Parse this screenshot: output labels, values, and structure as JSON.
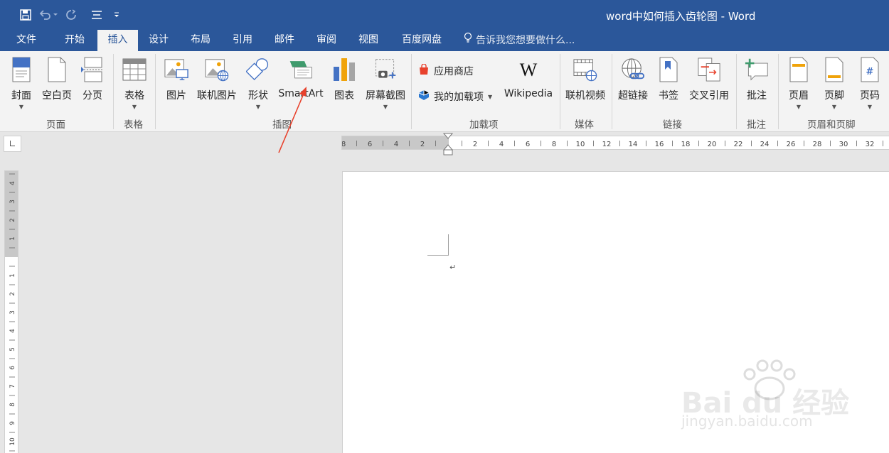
{
  "window": {
    "title": "word中如何插入齿轮图 - Word"
  },
  "quick_access": [
    {
      "icon": "save-icon"
    },
    {
      "icon": "undo-icon"
    },
    {
      "icon": "redo-icon"
    },
    {
      "icon": "touch-mode-icon"
    },
    {
      "icon": "customize-qat-icon"
    }
  ],
  "tabs": [
    "文件",
    "开始",
    "插入",
    "设计",
    "布局",
    "引用",
    "邮件",
    "审阅",
    "视图",
    "百度网盘"
  ],
  "active_tab": "插入",
  "tell_me": "告诉我您想要做什么...",
  "ribbon": {
    "groups": [
      "页面",
      "表格",
      "插图",
      "加载项",
      "媒体",
      "链接",
      "批注",
      "页眉和页脚"
    ],
    "buttons": [
      "封面",
      "空白页",
      "分页",
      "表格",
      "图片",
      "联机图片",
      "形状",
      "SmartArt",
      "图表",
      "屏幕截图",
      "Wikipedia",
      "联机视频",
      "超链接",
      "书签",
      "交叉引用",
      "批注",
      "页眉",
      "页脚",
      "页码"
    ],
    "small_buttons": [
      "应用商店",
      "我的加载项"
    ],
    "accent_color": "#2b579a"
  },
  "ruler": {
    "horizontal": [
      "8",
      "6",
      "4",
      "2",
      "2",
      "4",
      "6",
      "8",
      "10",
      "12",
      "14",
      "16",
      "18",
      "20",
      "22",
      "24",
      "26",
      "28",
      "30",
      "32"
    ],
    "vertical": [
      "4",
      "3",
      "2",
      "1",
      "1",
      "2",
      "3",
      "4",
      "5",
      "6",
      "7",
      "8",
      "9",
      "10"
    ]
  },
  "document": {
    "paragraph_mark": "↵"
  },
  "watermark": {
    "brand": "Bai du 经验",
    "url": "jingyan.baidu.com"
  }
}
